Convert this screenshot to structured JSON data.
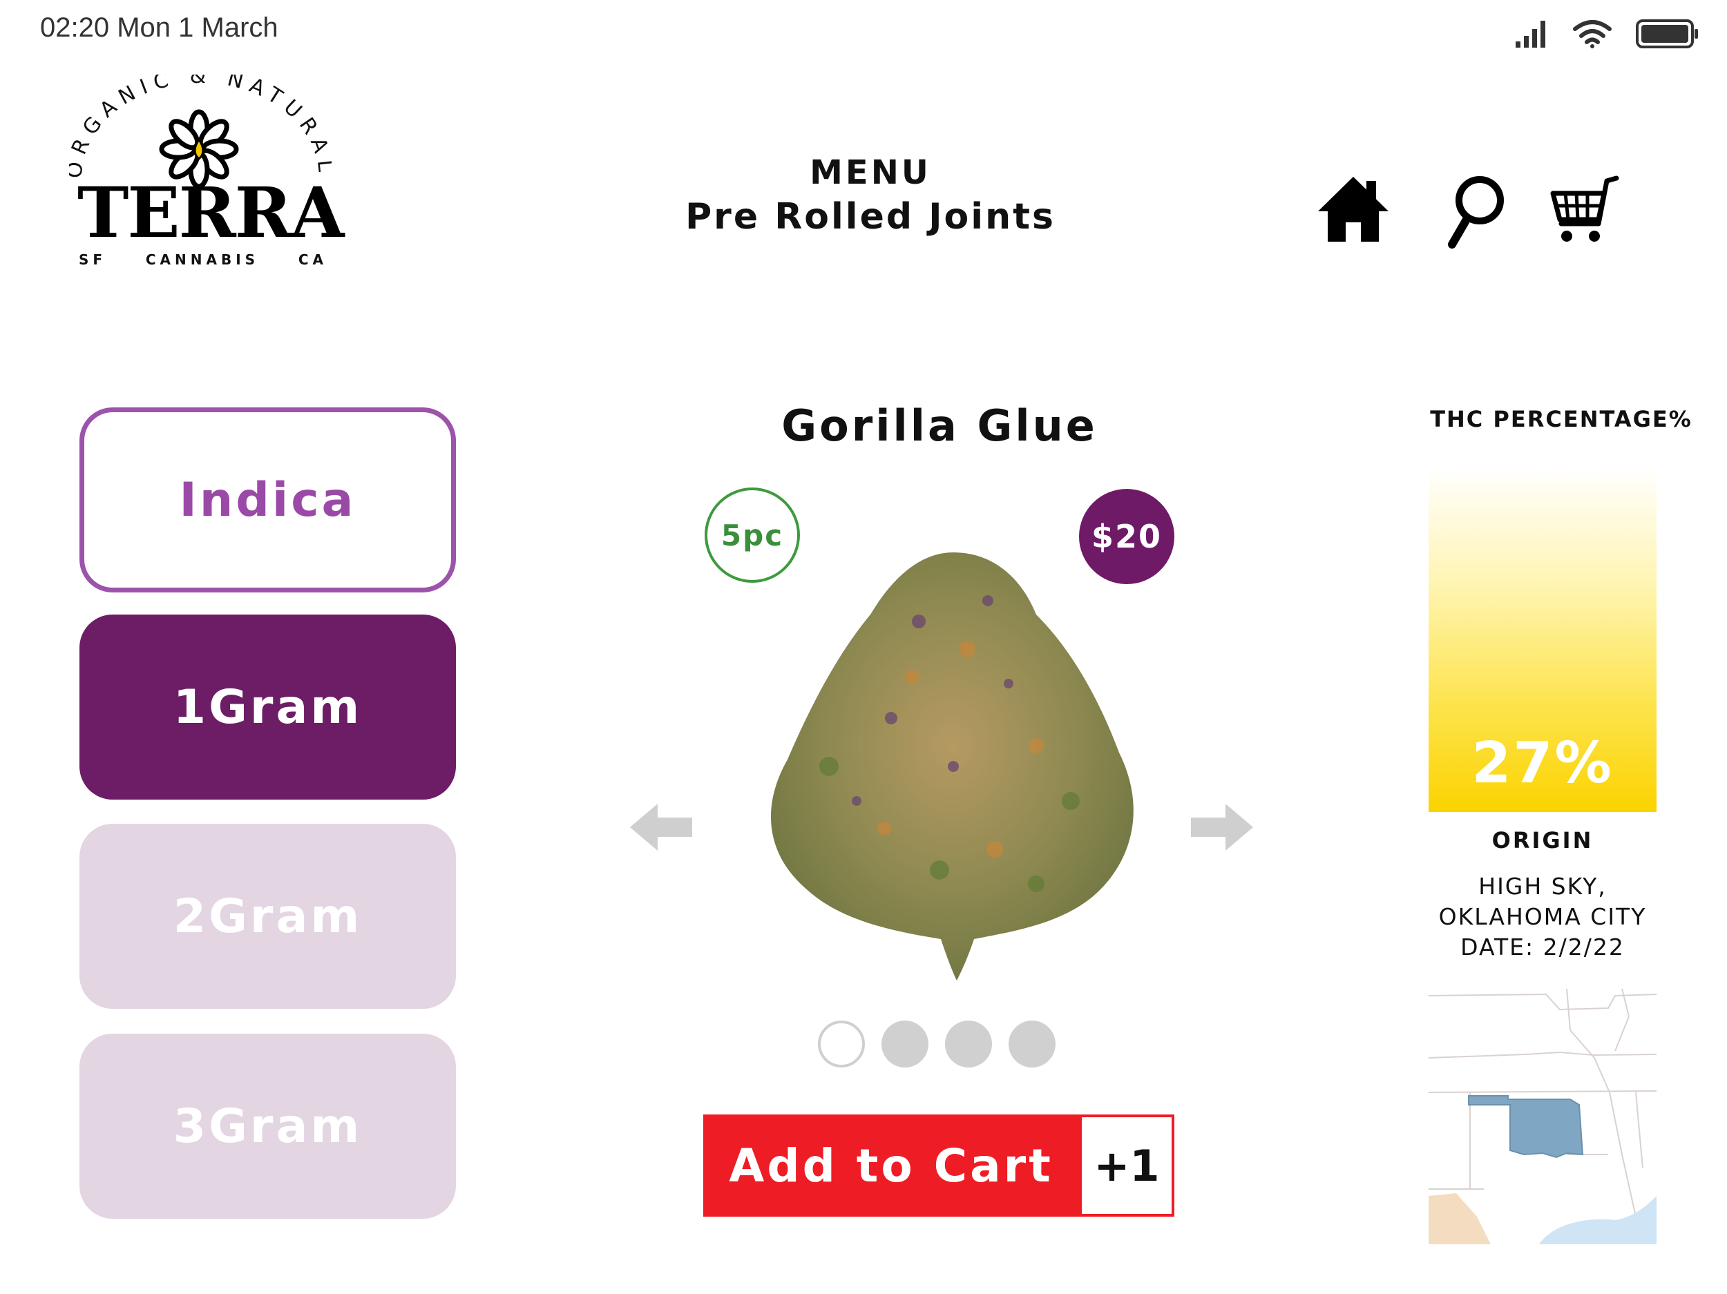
{
  "status_bar": {
    "time": "02:20 Mon 1 March"
  },
  "logo": {
    "arc_text": "ORGANIC & NATURAL",
    "wordmark": "TERRA",
    "left": "SF",
    "middle": "CANNABIS",
    "right": "CA"
  },
  "header": {
    "menu_label": "MENU",
    "category": "Pre Rolled Joints",
    "icons": [
      "home-icon",
      "search-icon",
      "cart-icon"
    ]
  },
  "options": {
    "strain": "Indica",
    "sizes": [
      "1Gram",
      "2Gram",
      "3Gram"
    ],
    "selected_size": "1Gram"
  },
  "product": {
    "name": "Gorilla Glue",
    "pieces": "5pc",
    "price": "$20",
    "carousel_index": 1,
    "carousel_count": 4
  },
  "cart": {
    "add_label": "Add to Cart",
    "quantity_label": "+1"
  },
  "details": {
    "thc_title": "THC PERCENTAGE%",
    "thc_value": "27%",
    "origin_label": "ORIGIN",
    "origin_line1": "HIGH SKY,",
    "origin_line2": "OKLAHOMA CITY",
    "date_line": "DATE: 2/2/22"
  },
  "colors": {
    "accent_purple": "#6c1d66",
    "indica_purple": "#9a4aa6",
    "inactive_lilac": "#e3d5e2",
    "cart_red": "#ee1c25",
    "pieces_green": "#3a8f3a",
    "thc_yellow": "#fbd300",
    "map_highlight": "#7fa7c4"
  }
}
